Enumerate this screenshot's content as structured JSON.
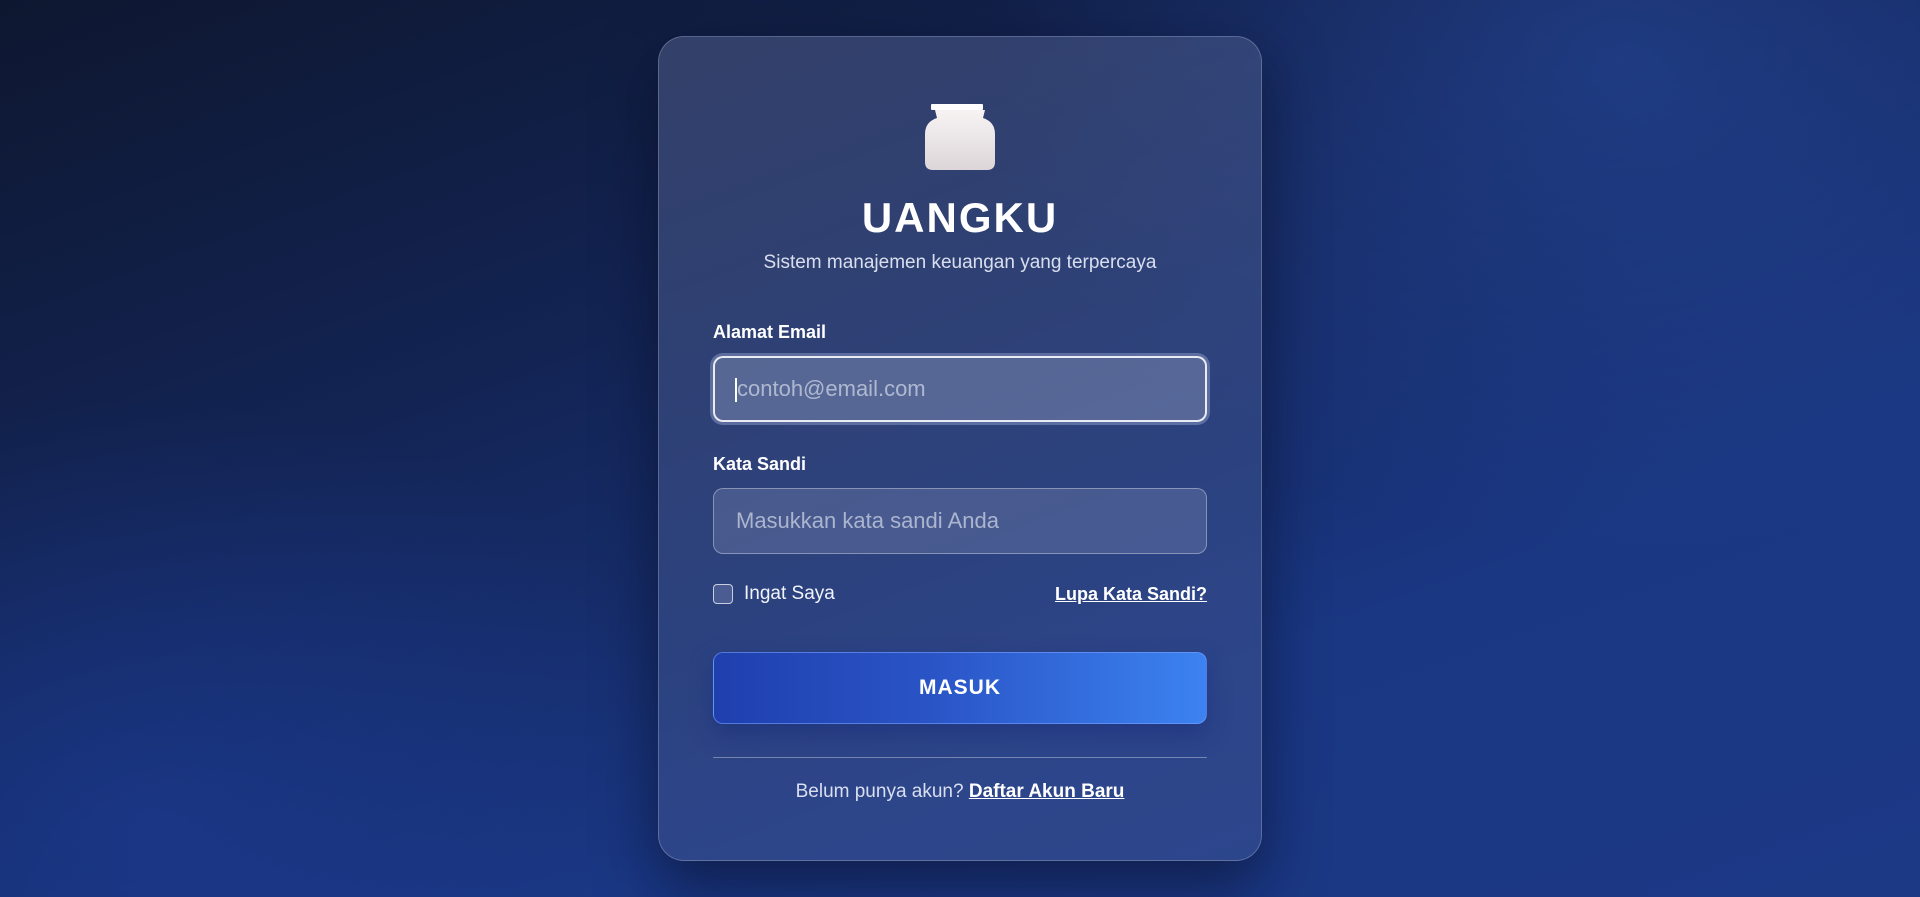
{
  "brand": {
    "title": "UANGKU",
    "subtitle": "Sistem manajemen keuangan yang terpercaya",
    "logo_icon": "money-bag-icon"
  },
  "form": {
    "email_label": "Alamat Email",
    "email_placeholder": "contoh@email.com",
    "email_value": "",
    "password_label": "Kata Sandi",
    "password_placeholder": "Masukkan kata sandi Anda",
    "password_value": "",
    "remember_label": "Ingat Saya",
    "remember_checked": false,
    "forgot_label": "Lupa Kata Sandi?",
    "submit_label": "MASUK"
  },
  "signup": {
    "prompt": "Belum punya akun?",
    "link_label": "Daftar Akun Baru"
  },
  "colors": {
    "accent_start": "#1f3fae",
    "accent_end": "#3c82f0",
    "background_dark": "#0e1730",
    "background_blue": "#1c3986"
  }
}
